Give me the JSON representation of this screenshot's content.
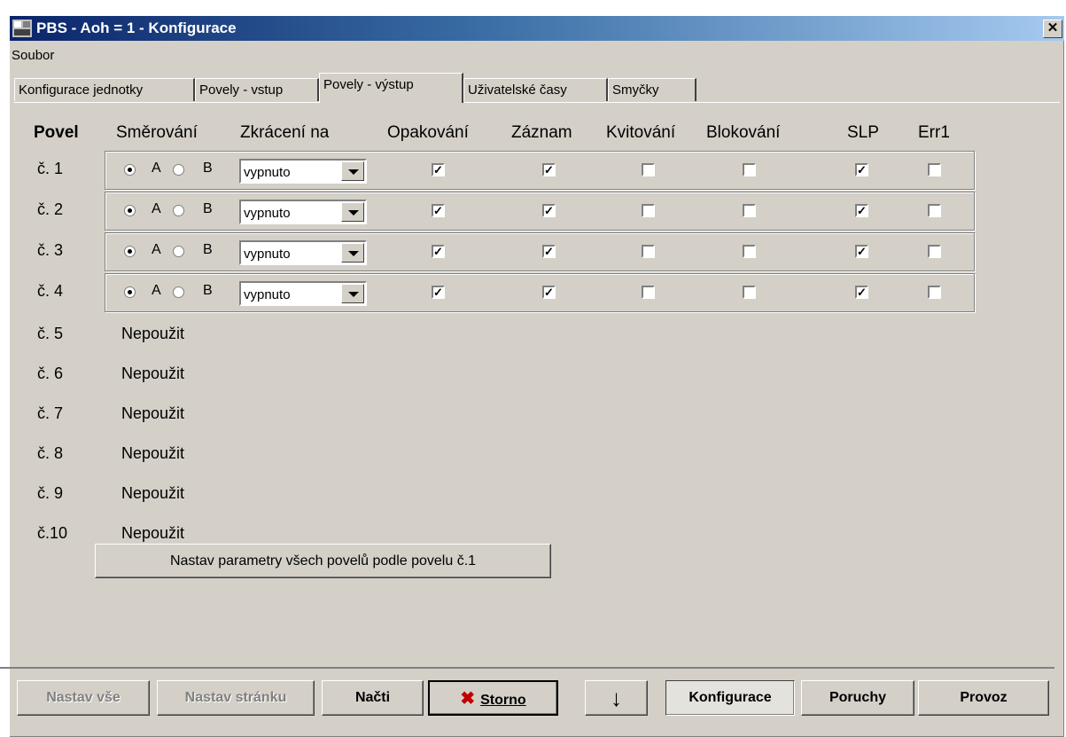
{
  "window": {
    "title": "PBS - Aoh = 1 - Konfigurace",
    "close_glyph": "✕"
  },
  "menu": {
    "items": [
      "Soubor"
    ]
  },
  "tabs": [
    "Konfigurace jednotky",
    "Povely - vstup",
    "Povely - výstup",
    "Uživatelské časy",
    "Smyčky"
  ],
  "active_tab": "Povely - výstup",
  "headers": {
    "povel": "Povel",
    "smerovani": "Směrování",
    "zkraceni": "Zkrácení na",
    "opakovani": "Opakování",
    "zaznam": "Záznam",
    "kvitovani": "Kvitování",
    "blokovani": "Blokování",
    "slp": "SLP",
    "err1": "Err1"
  },
  "radio_labels": {
    "a": "A",
    "b": "B"
  },
  "check_glyph": "✓",
  "active_rows": [
    {
      "label": "č. 1",
      "routing": "A",
      "shorten": "vypnuto",
      "opakovani": true,
      "zaznam": true,
      "kvitovani": false,
      "blokovani": false,
      "slp": true,
      "err1": false
    },
    {
      "label": "č. 2",
      "routing": "A",
      "shorten": "vypnuto",
      "opakovani": true,
      "zaznam": true,
      "kvitovani": false,
      "blokovani": false,
      "slp": true,
      "err1": false
    },
    {
      "label": "č. 3",
      "routing": "A",
      "shorten": "vypnuto",
      "opakovani": true,
      "zaznam": true,
      "kvitovani": false,
      "blokovani": false,
      "slp": true,
      "err1": false
    },
    {
      "label": "č. 4",
      "routing": "A",
      "shorten": "vypnuto",
      "opakovani": true,
      "zaznam": true,
      "kvitovani": false,
      "blokovani": false,
      "slp": true,
      "err1": false
    }
  ],
  "unused_rows": [
    {
      "label": "č. 5",
      "status": "Nepoužit"
    },
    {
      "label": "č. 6",
      "status": "Nepoužit"
    },
    {
      "label": "č. 7",
      "status": "Nepoužit"
    },
    {
      "label": "č. 8",
      "status": "Nepoužit"
    },
    {
      "label": "č. 9",
      "status": "Nepoužit"
    },
    {
      "label": "č.10",
      "status": "Nepoužit"
    }
  ],
  "set_all_button": "Nastav parametry všech povelů podle povelu č.1",
  "bottom": {
    "nastav_vse": "Nastav vše",
    "nastav_stranku": "Nastav stránku",
    "nacti": "Načti",
    "storno": "Storno",
    "storno_icon": "✖",
    "arrow": "↓",
    "konfigurace": "Konfigurace",
    "poruchy": "Poruchy",
    "provoz": "Provoz"
  }
}
